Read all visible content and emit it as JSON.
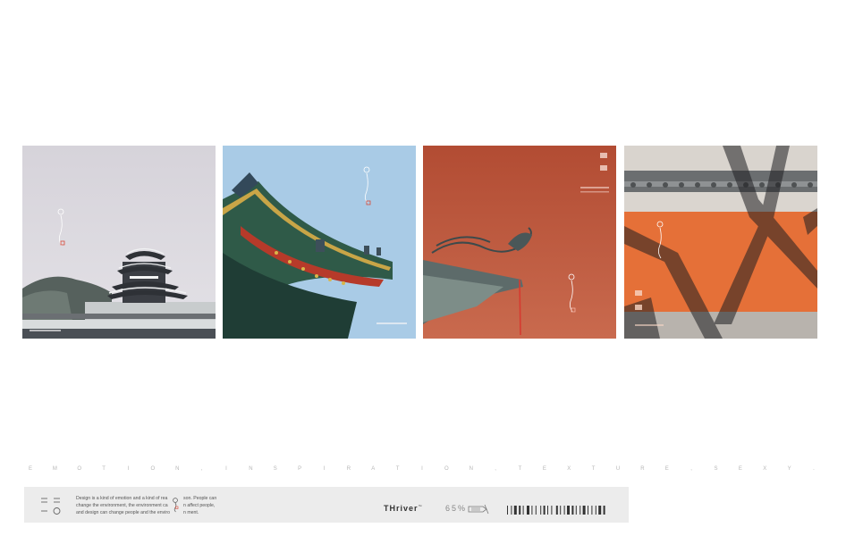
{
  "tagline": "E M O T I O N , I N S P I R A T I O N , T E X T U R E , S E X Y .",
  "footer": {
    "description_line1": "Design is a kind of emotion and a kind of rea",
    "description_line2": "change the environment, the environment ca",
    "description_line3": "and design can change people and the enviro",
    "description2_line1": "son. People can",
    "description2_line2": "n affect people,",
    "description2_line3": "n ment.",
    "brand": "THriver",
    "brand_tm": "™",
    "percent": "65%"
  },
  "colors": {
    "sky_grey": "#d9d6dc",
    "sky_blue": "#a9cbe6",
    "wall_red": "#c15b3e",
    "wall_orange": "#e57038",
    "seal_red": "#d64a3a"
  }
}
